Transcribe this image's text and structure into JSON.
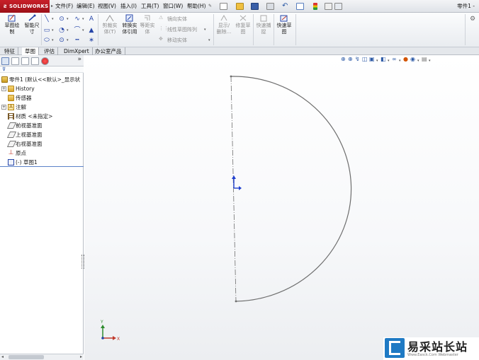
{
  "app": {
    "logo_text": "SOLIDWORKS",
    "doc_title": "零件1 -"
  },
  "menu": {
    "items": [
      "文件(F)",
      "编辑(E)",
      "视图(V)",
      "插入(I)",
      "工具(T)",
      "窗口(W)",
      "帮助(H)"
    ]
  },
  "command_manager": {
    "sketch_btn": "草图绘\n制",
    "dimension_btn": "智能尺\n寸",
    "trim_btn": "剪裁实\n体(T)",
    "convert_btn": "转换实\n体引用",
    "offset_btn": "等距实\n体",
    "mirror_label": "镜向实体",
    "linear_pattern_label": "线性草图阵列",
    "move_label": "移动实体",
    "display_delete_btn": "显示/\n删除...",
    "repair_btn": "修复草\n图",
    "quick_snap_btn": "快速捕\n捉",
    "rapid_sketch_btn": "快速草\n图"
  },
  "tabs": [
    "特征",
    "草图",
    "评估",
    "DimXpert",
    "办公室产品"
  ],
  "active_tab": "草图",
  "feature_tree": {
    "root": "零件1 (默认<<默认>_显示状",
    "items": [
      {
        "label": "History",
        "icon": "history-folder-icon",
        "expandable": true
      },
      {
        "label": "传感器",
        "icon": "sensor-folder-icon",
        "expandable": false
      },
      {
        "label": "注解",
        "icon": "annotation-icon",
        "expandable": true
      },
      {
        "label": "材质 <未指定>",
        "icon": "material-icon",
        "expandable": false
      },
      {
        "label": "前视基准面",
        "icon": "plane-icon",
        "expandable": false
      },
      {
        "label": "上视基准面",
        "icon": "plane-icon",
        "expandable": false
      },
      {
        "label": "右视基准面",
        "icon": "plane-icon",
        "expandable": false
      },
      {
        "label": "原点",
        "icon": "origin-icon",
        "expandable": false
      },
      {
        "label": "(-) 草图1",
        "icon": "sketch-icon",
        "expandable": false
      }
    ]
  },
  "triad": {
    "x": "X",
    "y": "Y"
  },
  "watermark": {
    "title": "易采站长站",
    "url": "Www.Easck.Com Webmaster"
  },
  "colors": {
    "brand_red": "#c8202a",
    "sketch_line": "#6e6e6e",
    "origin_blue": "#1f3fd0",
    "axis_green": "#2e8b2e",
    "axis_red": "#c0392b"
  }
}
